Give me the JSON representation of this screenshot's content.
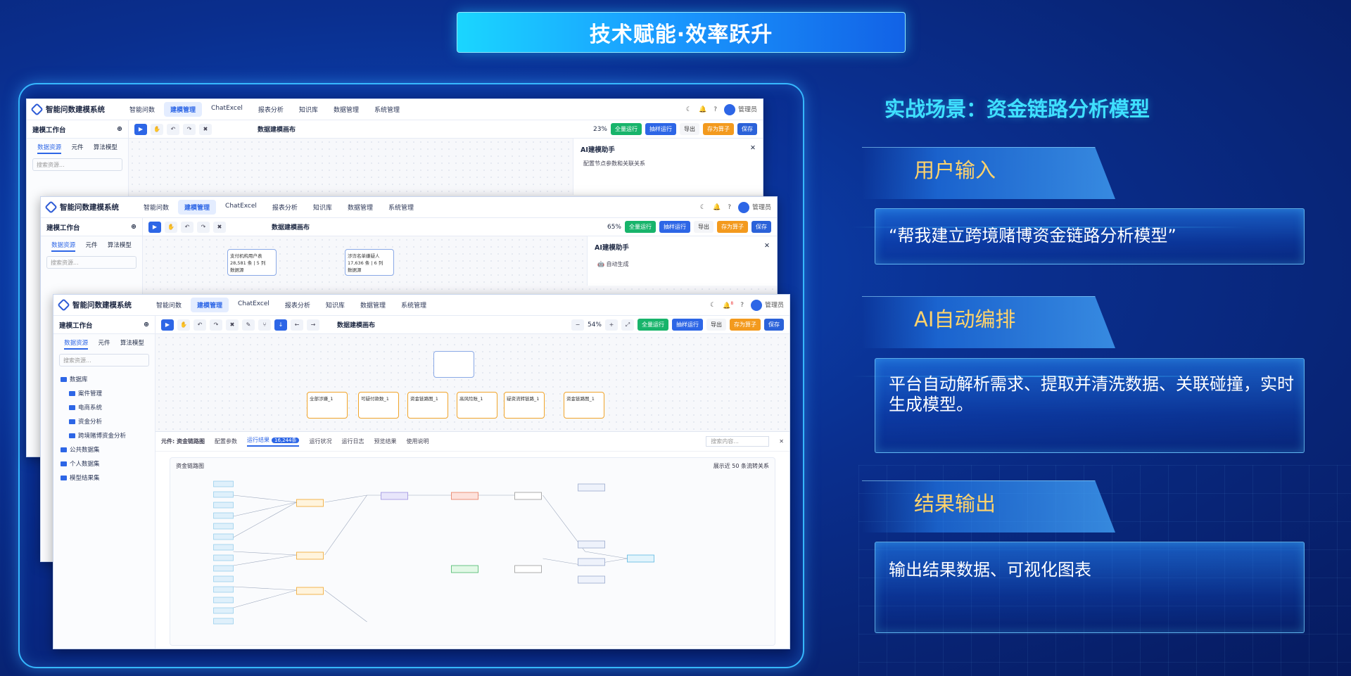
{
  "banner": {
    "title": "技术赋能·效率跃升"
  },
  "app": {
    "name": "智能问数建模系统",
    "nav": [
      "智能问数",
      "建模管理",
      "ChatExcel",
      "报表分析",
      "知识库",
      "数据管理",
      "系统管理"
    ],
    "active_nav": "建模管理",
    "user": "管理员",
    "notification_count": "8",
    "workbench_title": "建模工作台",
    "side_tabs": [
      "数据资源",
      "元件",
      "算法模型"
    ],
    "search_placeholder": "搜索资源...",
    "canvas_title": "数据建模画布",
    "zoom_levels": [
      "23%",
      "65%",
      "54%"
    ],
    "actions": {
      "run_all": "全量运行",
      "sample_run": "抽样运行",
      "export": "导出",
      "save_as_operator": "存为算子",
      "save": "保存"
    },
    "assistant": {
      "title": "AI建模助手",
      "step1": "配置节点参数和关联关系",
      "step2": "自动生成"
    },
    "tree": {
      "root": "数据库",
      "children": [
        "案件管理",
        "电商系统",
        "资金分析",
        "跨境赌博资金分析"
      ],
      "others": [
        "公共数据集",
        "个人数据集",
        "模型结果集"
      ]
    },
    "mid_nodes": [
      {
        "title": "支付机构用户表",
        "rows": "28,581 条 | 5 列",
        "tag": "数据源"
      },
      {
        "title": "涉诈名单嫌疑人",
        "rows": "17,636 条 | 6 列",
        "tag": "数据源"
      }
    ],
    "front_nodes": [
      "全部涉嫌_1",
      "可疑付款数_1",
      "资金链路图_1",
      "高风险账_1",
      "疑资流转链路_1",
      "资金链路图_1"
    ],
    "bottom_panel": {
      "element_label": "元件: 资金链路图",
      "tabs": [
        "配置参数",
        "运行结果",
        "运行状况",
        "运行日志",
        "预览结果",
        "使用说明"
      ],
      "active_tab": "运行结果",
      "result_count": "16,244条",
      "search_placeholder": "搜索内容...",
      "graph_title": "资金链路图",
      "graph_note": "展示近 50 条流转关系"
    }
  },
  "right": {
    "scenario_title": "实战场景：资金链路分析模型",
    "stages": [
      {
        "label": "用户输入",
        "text": "“帮我建立跨境赌博资金链路分析模型”"
      },
      {
        "label": "AI自动编排",
        "text": "平台自动解析需求、提取并清洗数据、关联碰撞，实时生成模型。"
      },
      {
        "label": "结果输出",
        "text": "输出结果数据、可视化图表"
      }
    ]
  }
}
